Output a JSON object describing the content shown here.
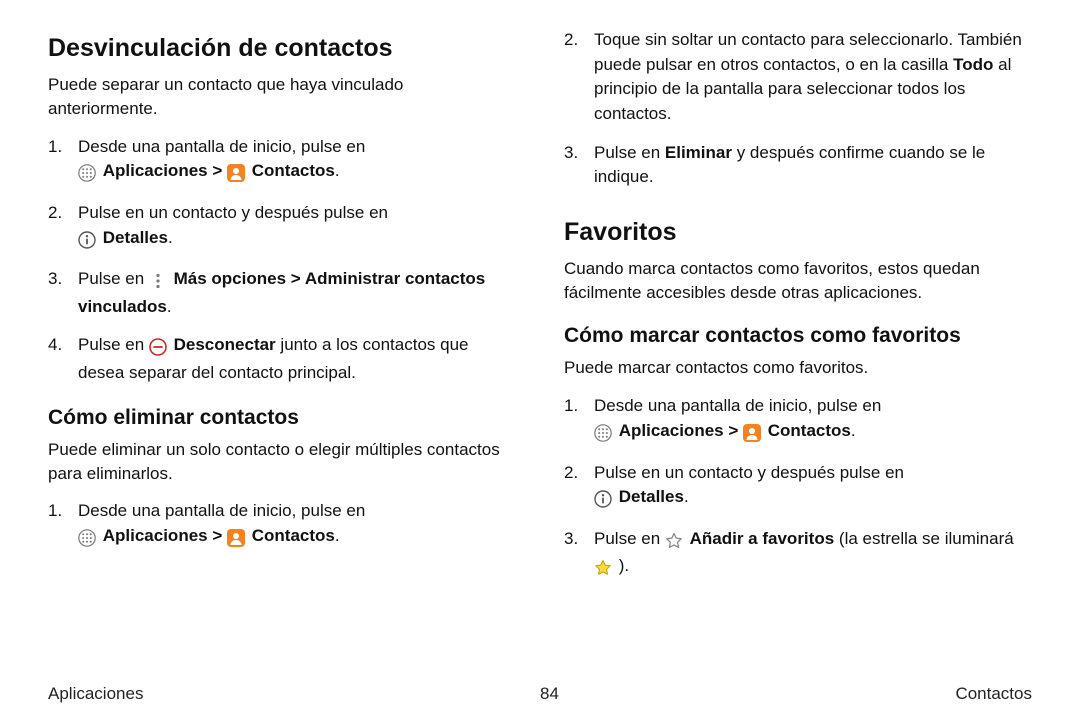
{
  "left": {
    "h_unlink": "Desvinculación de contactos",
    "p_unlink": "Puede separar un contacto que haya vinculado anteriormente.",
    "step1a": "Desde una pantalla de inicio, pulse en ",
    "apps_label": "Aplicaciones",
    "contacts_label": "Contactos",
    "sep": " > ",
    "period": ".",
    "step2a": "Pulse en un contacto y después pulse en ",
    "details_label": "Detalles",
    "step3a": "Pulse en ",
    "more_opts": "Más opciones",
    "manage_linked": "Administrar contactos vinculados",
    "step4a": "Pulse en ",
    "disconnect": "Desconectar",
    "step4b": " junto a los contactos que desea separar del contacto principal.",
    "h_delete": "Cómo eliminar contactos",
    "p_delete": "Puede eliminar un solo contacto o elegir múltiples contactos para eliminarlos.",
    "d_step1a": "Desde una pantalla de inicio, pulse en "
  },
  "right": {
    "d_step2": "Toque sin soltar un contacto para seleccionarlo. También puede pulsar en otros contactos, o en la casilla ",
    "todo": "Todo",
    "d_step2b": " al principio de la pantalla para seleccionar todos los contactos.",
    "d_step3a": "Pulse en ",
    "eliminar": "Eliminar",
    "d_step3b": " y después confirme cuando se le indique.",
    "h_fav": "Favoritos",
    "p_fav": "Cuando marca contactos como favoritos, estos quedan fácilmente accesibles desde otras aplicaciones.",
    "h_mark": "Cómo marcar contactos como favoritos",
    "p_mark": "Puede marcar contactos como favoritos.",
    "f_step1a": "Desde una pantalla de inicio, pulse en ",
    "f_step2a": "Pulse en un contacto y después pulse en ",
    "f_step3a": "Pulse en ",
    "add_fav": "Añadir a favoritos",
    "f_step3b": " (la estrella se iluminará ",
    "f_step3c": ")."
  },
  "footer": {
    "left": "Aplicaciones",
    "center": "84",
    "right": "Contactos"
  }
}
